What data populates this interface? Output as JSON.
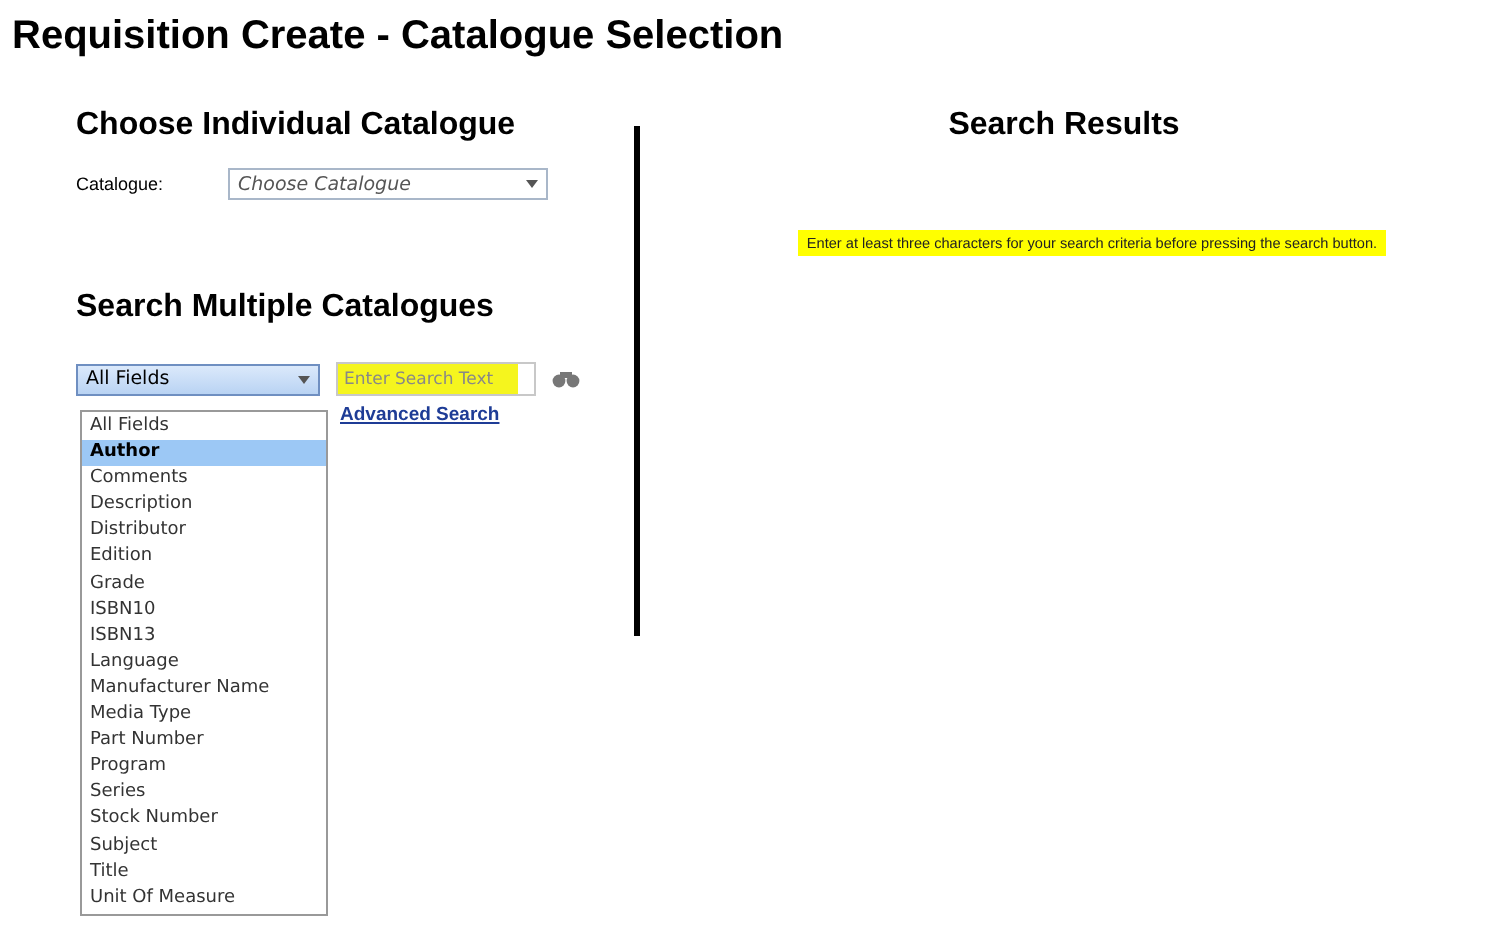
{
  "page_title": "Requisition Create - Catalogue Selection",
  "individual": {
    "heading": "Choose Individual Catalogue",
    "label": "Catalogue:",
    "select_value": "Choose Catalogue"
  },
  "multiple": {
    "heading": "Search Multiple Catalogues",
    "field_select": "All Fields",
    "search": {
      "placeholder": "Enter Search Text"
    },
    "advanced_link": "Advanced Search",
    "options": [
      {
        "label": "All Fields",
        "selected": false
      },
      {
        "label": "Author",
        "selected": true
      },
      {
        "label": "Comments",
        "selected": false
      },
      {
        "label": "Description",
        "selected": false
      },
      {
        "label": "Distributor",
        "selected": false
      },
      {
        "label": "Edition",
        "selected": false
      },
      {
        "label": "Grade",
        "selected": false
      },
      {
        "label": "ISBN10",
        "selected": false
      },
      {
        "label": "ISBN13",
        "selected": false
      },
      {
        "label": "Language",
        "selected": false
      },
      {
        "label": "Manufacturer Name",
        "selected": false
      },
      {
        "label": "Media Type",
        "selected": false
      },
      {
        "label": "Part Number",
        "selected": false
      },
      {
        "label": "Program",
        "selected": false
      },
      {
        "label": "Series",
        "selected": false
      },
      {
        "label": "Stock Number",
        "selected": false
      },
      {
        "label": "Subject",
        "selected": false
      },
      {
        "label": "Title",
        "selected": false
      },
      {
        "label": "Unit Of Measure",
        "selected": false
      }
    ]
  },
  "results": {
    "heading": "Search Results",
    "message": "Enter at least three characters for your search criteria before pressing the search button."
  }
}
